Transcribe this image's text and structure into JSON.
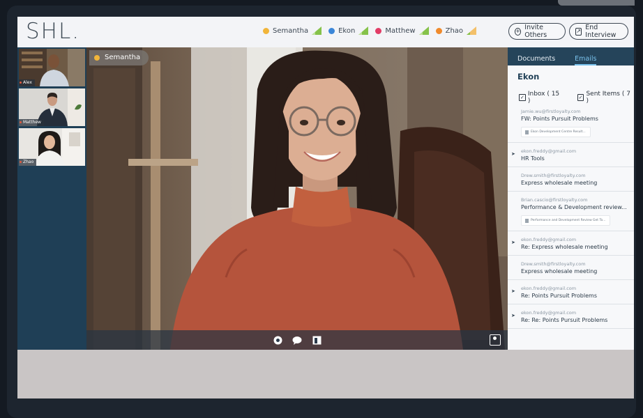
{
  "app": {
    "logo": "SHL."
  },
  "header": {
    "participants": [
      {
        "name": "Semantha",
        "color": "#f1b53a"
      },
      {
        "name": "Ekon",
        "color": "#3b86d8"
      },
      {
        "name": "Matthew",
        "color": "#e23c66"
      },
      {
        "name": "Zhao",
        "color": "#f08a2c"
      }
    ],
    "invite_label": "Invite Others",
    "end_label": "End Interview"
  },
  "thumbnails": [
    {
      "name": "Alex"
    },
    {
      "name": "Matthew"
    },
    {
      "name": "Zhao"
    }
  ],
  "video": {
    "active_speaker": "Semantha"
  },
  "panel": {
    "tabs": [
      {
        "label": "Documents",
        "active": false
      },
      {
        "label": "Emails",
        "active": true
      }
    ],
    "contact_name": "Ekon",
    "inbox_label": "Inbox ( 15 )",
    "sent_label": "Sent Items ( 7 )",
    "emails": [
      {
        "from": "Jamie.wu@firstloyalty.com",
        "subject": "FW: Points Pursuit Problems",
        "attachment": "Ekon Development Centre Result...",
        "reply": false
      },
      {
        "from": "ekon.freddy@gmail.com",
        "subject": "HR Tools",
        "attachment": null,
        "reply": true
      },
      {
        "from": "Drew.smith@firstloyalty.com",
        "subject": "Express wholesale meeting",
        "attachment": null,
        "reply": false
      },
      {
        "from": "Brian.cascio@firstloyalty.com",
        "subject": "Performance & Development review...",
        "attachment": "Performance and Development Review Get To...",
        "reply": false
      },
      {
        "from": "ekon.freddy@gmail.com",
        "subject": "Re: Express wholesale meeting",
        "attachment": null,
        "reply": true
      },
      {
        "from": "Drew.smith@firstloyalty.com",
        "subject": "Express wholesale meeting",
        "attachment": null,
        "reply": false
      },
      {
        "from": "ekon.freddy@gmail.com",
        "subject": "Re: Points Pursuit Problems",
        "attachment": null,
        "reply": true
      },
      {
        "from": "ekon.freddy@gmail.com",
        "subject": "Re: Re: Points Pursuit Problems",
        "attachment": null,
        "reply": true
      }
    ]
  }
}
